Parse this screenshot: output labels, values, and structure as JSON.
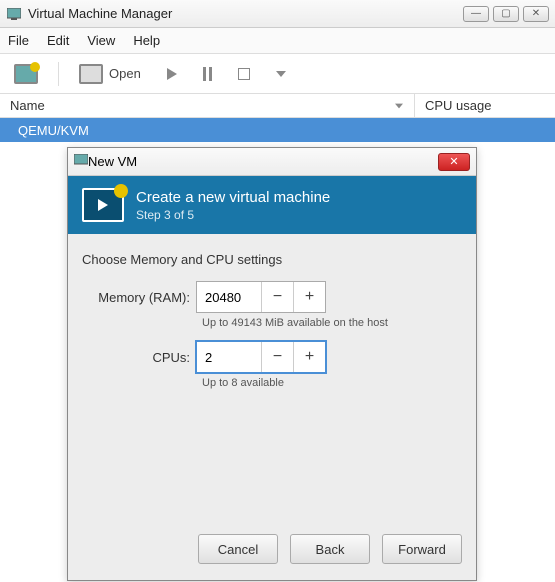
{
  "window": {
    "title": "Virtual Machine Manager"
  },
  "menu": {
    "file": "File",
    "edit": "Edit",
    "view": "View",
    "help": "Help"
  },
  "toolbar": {
    "open": "Open"
  },
  "columns": {
    "name": "Name",
    "cpu": "CPU usage"
  },
  "rows": [
    {
      "name": "QEMU/KVM"
    }
  ],
  "dialog": {
    "title": "New VM",
    "wizard_title": "Create a new virtual machine",
    "step": "Step 3 of 5",
    "section_title": "Choose Memory and CPU settings",
    "memory_label": "Memory (RAM):",
    "memory_value": "20480",
    "memory_hint": "Up to 49143 MiB available on the host",
    "cpu_label": "CPUs:",
    "cpu_value": "2",
    "cpu_hint": "Up to 8 available",
    "cancel": "Cancel",
    "back": "Back",
    "forward": "Forward"
  }
}
